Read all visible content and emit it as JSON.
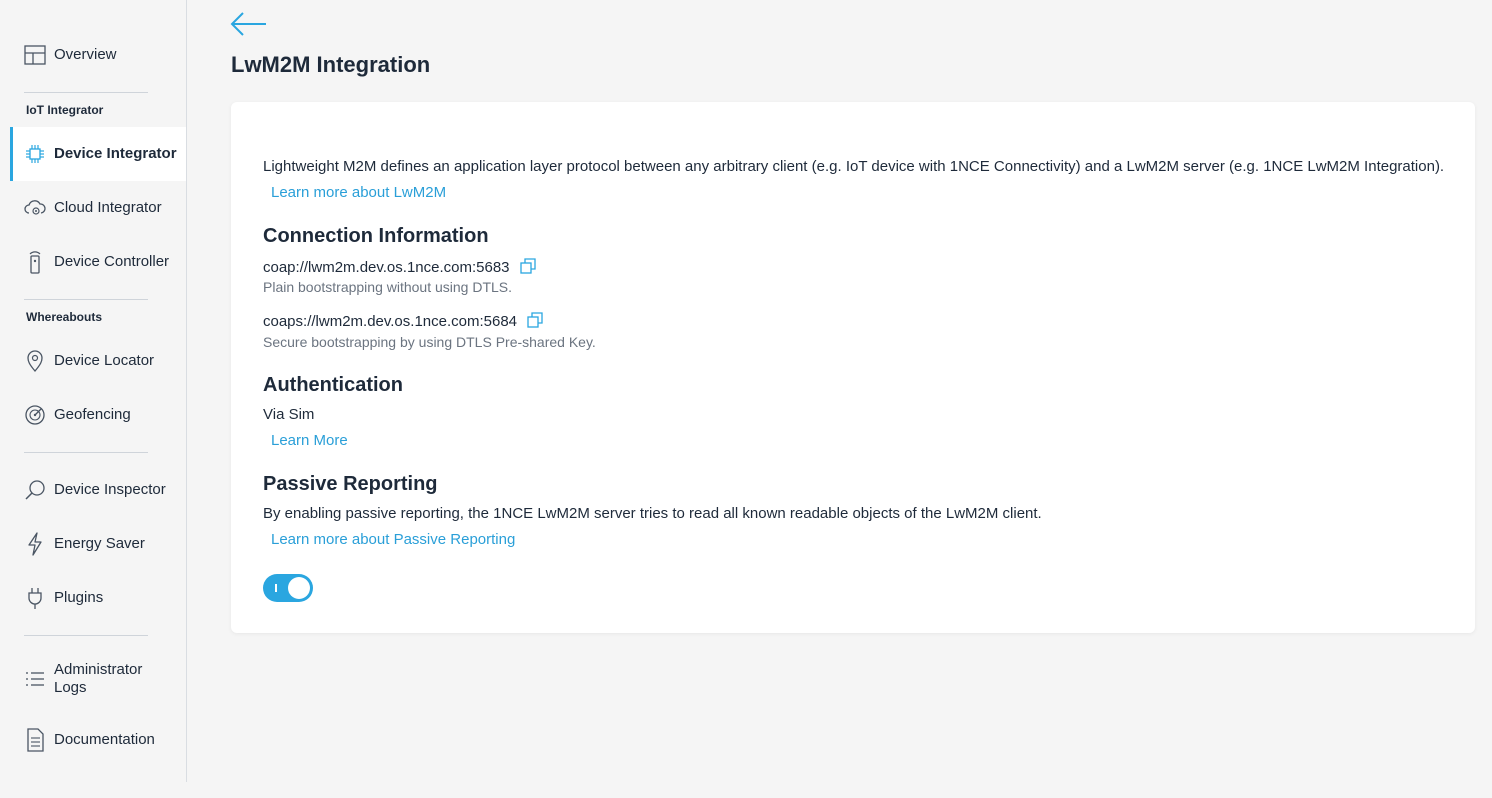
{
  "sidebar": {
    "items": [
      {
        "label": "Overview",
        "icon": "layout-icon"
      },
      {
        "label": "Device Integrator",
        "icon": "chip-icon",
        "active": true
      },
      {
        "label": "Cloud Integrator",
        "icon": "cloud-gear-icon"
      },
      {
        "label": "Device Controller",
        "icon": "remote-icon"
      },
      {
        "label": "Device Locator",
        "icon": "map-pin-icon"
      },
      {
        "label": "Geofencing",
        "icon": "radar-icon"
      },
      {
        "label": "Device Inspector",
        "icon": "magnifier-icon"
      },
      {
        "label": "Energy Saver",
        "icon": "lightning-icon"
      },
      {
        "label": "Plugins",
        "icon": "plug-icon"
      },
      {
        "label": "Administrator Logs",
        "icon": "list-icon"
      },
      {
        "label": "Documentation",
        "icon": "document-icon"
      }
    ],
    "sections": [
      "IoT Integrator",
      "Whereabouts"
    ]
  },
  "page": {
    "title": "LwM2M Integration"
  },
  "card": {
    "intro": "Lightweight M2M defines an application layer protocol between any arbitrary client (e.g. IoT device with 1NCE Connectivity) and a LwM2M server (e.g. 1NCE LwM2M Integration).",
    "intro_link": "Learn more about LwM2M",
    "connection": {
      "heading": "Connection Information",
      "entries": [
        {
          "url": "coap://lwm2m.dev.os.1nce.com:5683",
          "desc": "Plain bootstrapping without using DTLS."
        },
        {
          "url": "coaps://lwm2m.dev.os.1nce.com:5684",
          "desc": "Secure bootstrapping by using DTLS Pre-shared Key."
        }
      ]
    },
    "auth": {
      "heading": "Authentication",
      "value": "Via Sim",
      "link": "Learn More"
    },
    "passive": {
      "heading": "Passive Reporting",
      "text": "By enabling passive reporting, the 1NCE LwM2M server tries to read all known readable objects of the LwM2M client.",
      "link": "Learn more about Passive Reporting",
      "enabled": true
    }
  },
  "colors": {
    "accent": "#2aa6e0",
    "link": "#2a9fd8",
    "text": "#1e2a3a",
    "background": "#f5f5f5"
  }
}
